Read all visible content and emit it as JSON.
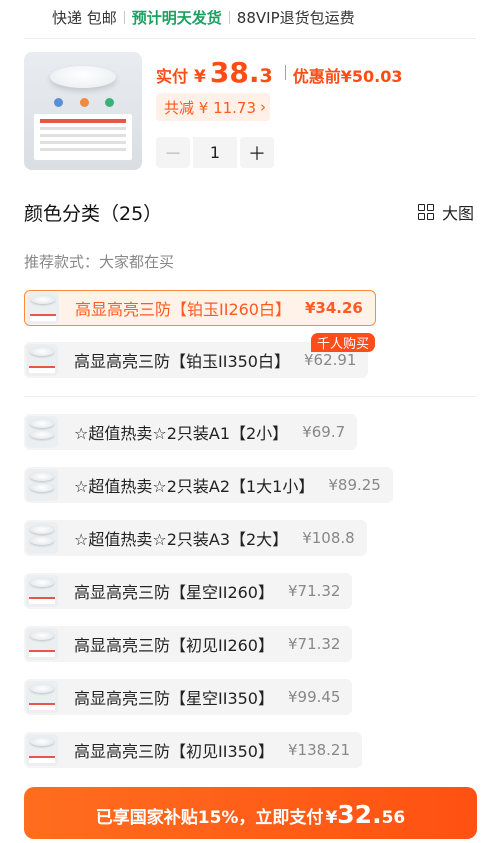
{
  "shipping": {
    "express": "快递 包邮",
    "eta": "预计明天发货",
    "vip": "88VIP退货包运费"
  },
  "product": {
    "price_label": "实付",
    "currency": "¥",
    "price_int": "38.",
    "price_dec": "3",
    "original_label": "优惠前",
    "original_price": "¥50.03",
    "discount_text": "共减 ¥ 11.73",
    "quantity": "1",
    "minus": "－",
    "plus": "＋"
  },
  "section": {
    "title": "颜色分类（25）",
    "big_view_label": "大图",
    "recommend_label": "推荐款式：大家都在买",
    "hot_badge": "千人购买"
  },
  "options": [
    {
      "name": "高显高亮三防【铂玉II260白】",
      "price": "¥34.26",
      "selected": true
    },
    {
      "name": "高显高亮三防【铂玉II350白】",
      "price": "¥62.91",
      "selected": false
    },
    {
      "name": "☆超值热卖☆2只装A1【2小】",
      "price": "¥69.7",
      "selected": false
    },
    {
      "name": "☆超值热卖☆2只装A2【1大1小】",
      "price": "¥89.25",
      "selected": false
    },
    {
      "name": "☆超值热卖☆2只装A3【2大】",
      "price": "¥108.8",
      "selected": false
    },
    {
      "name": "高显高亮三防【星空II260】",
      "price": "¥71.32",
      "selected": false
    },
    {
      "name": "高显高亮三防【初见II260】",
      "price": "¥71.32",
      "selected": false
    },
    {
      "name": "高显高亮三防【星空II350】",
      "price": "¥99.45",
      "selected": false
    },
    {
      "name": "高显高亮三防【初见II350】",
      "price": "¥138.21",
      "selected": false
    }
  ],
  "pay_button": {
    "text": "已享国家补贴15%，立即支付",
    "currency": "¥",
    "amount_int": "32.",
    "amount_dec": "56"
  },
  "colors": {
    "accent": "#ff4b14",
    "green": "#1aa260"
  }
}
